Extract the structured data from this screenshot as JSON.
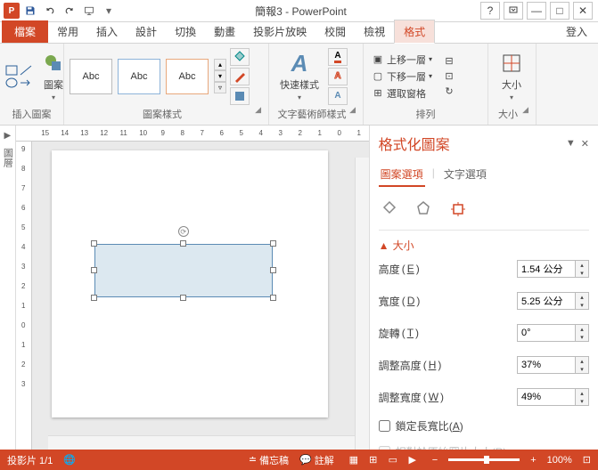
{
  "title": "簡報3 - PowerPoint",
  "login": "登入",
  "tabs": {
    "file": "檔案",
    "items": [
      "常用",
      "插入",
      "設計",
      "切換",
      "動畫",
      "投影片放映",
      "校閱",
      "檢視",
      "格式"
    ],
    "active": "格式"
  },
  "ribbon": {
    "insert_shape": {
      "label": "圖案",
      "group": "插入圖案"
    },
    "shape_styles": {
      "sample": "Abc",
      "group": "圖案樣式"
    },
    "wordart": {
      "label": "快速樣式",
      "group": "文字藝術師樣式"
    },
    "arrange": {
      "bring_forward": "上移一層",
      "send_backward": "下移一層",
      "selection_pane": "選取窗格",
      "group": "排列"
    },
    "size": {
      "label": "大小",
      "group": "大小"
    }
  },
  "ruler_h": [
    "15",
    "14",
    "13",
    "12",
    "11",
    "10",
    "9",
    "8",
    "7",
    "6",
    "5",
    "4",
    "3",
    "2",
    "1",
    "0",
    "1"
  ],
  "ruler_v": [
    "9",
    "8",
    "7",
    "6",
    "5",
    "4",
    "3",
    "2",
    "1",
    "0",
    "1",
    "2",
    "3"
  ],
  "left_panel": "圖層",
  "pane": {
    "title": "格式化圖案",
    "tab_shape": "圖案選項",
    "tab_text": "文字選項",
    "section_size": "大小",
    "fields": {
      "height": {
        "label": "高度",
        "key": "E",
        "value": "1.54 公分"
      },
      "width": {
        "label": "寬度",
        "key": "D",
        "value": "5.25 公分"
      },
      "rotation": {
        "label": "旋轉",
        "key": "T",
        "value": "0°"
      },
      "scale_h": {
        "label": "調整高度",
        "key": "H",
        "value": "37%"
      },
      "scale_w": {
        "label": "調整寬度",
        "key": "W",
        "value": "49%"
      }
    },
    "lock_aspect": {
      "label": "鎖定長寬比",
      "key": "A"
    },
    "relative_orig": {
      "label": "相對於原始圖片大小",
      "key": "R"
    }
  },
  "status": {
    "slide": "投影片 1/1",
    "lang": "",
    "memo": "備忘稿",
    "comment": "註解",
    "zoom": "100%"
  }
}
